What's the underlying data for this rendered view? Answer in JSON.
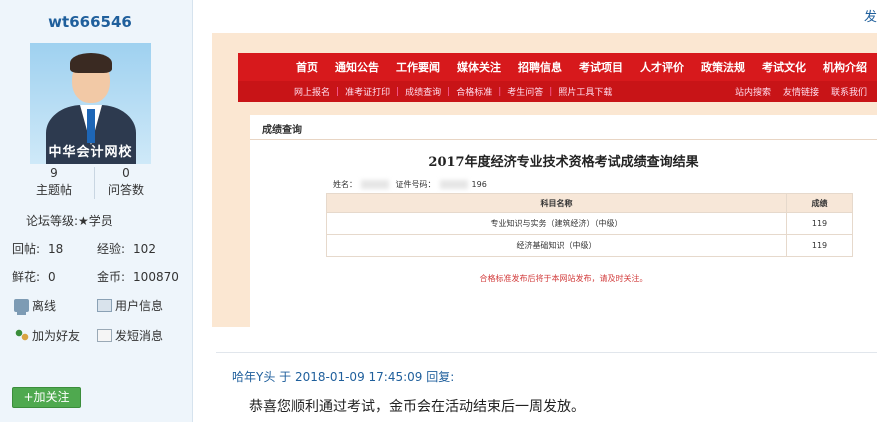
{
  "user": {
    "name": "wt666546",
    "avatar_text": "中华会计网校",
    "topics_count": "9",
    "topics_label": "主题帖",
    "questions_count": "0",
    "questions_label": "问答数",
    "level_label": "论坛等级:",
    "level_value": "★学员",
    "replies_label": "回帖:",
    "replies_value": "18",
    "exp_label": "经验:",
    "exp_value": "102",
    "flowers_label": "鲜花:",
    "flowers_value": "0",
    "coins_label": "金币:",
    "coins_value": "100870",
    "status_label": "离线",
    "userinfo_label": "用户信息",
    "add_friend_label": "加为好友",
    "send_msg_label": "发短消息",
    "follow_label": "+加关注"
  },
  "top_link": "发",
  "screenshot": {
    "nav": [
      "首页",
      "通知公告",
      "工作要闻",
      "媒体关注",
      "招聘信息",
      "考试项目",
      "人才评价",
      "政策法规",
      "考试文化",
      "机构介绍"
    ],
    "subnav": [
      "网上报名",
      "准考证打印",
      "成绩查询",
      "合格标准",
      "考生问答",
      "照片工具下载"
    ],
    "subnav_right": [
      "站内搜索",
      "友情链接",
      "联系我们"
    ],
    "panel_title": "成绩查询",
    "result_title": "2017年度经济专业技术资格考试成绩查询结果",
    "name_label": "姓名：",
    "id_label": "证件号码：",
    "id_suffix": "196",
    "col_subject": "科目名称",
    "col_score": "成绩",
    "rows": [
      {
        "subject": "专业知识与实务（建筑经济）（中级）",
        "score": "119"
      },
      {
        "subject": "经济基础知识（中级）",
        "score": "119"
      }
    ],
    "note": "合格标准发布后将于本网站发布，请及时关注。"
  },
  "reply": {
    "header": "哈年Y头 于 2018-01-09 17:45:09 回复:",
    "text": "恭喜您顺利通过考试，金币会在活动结束后一周发放。"
  },
  "colors": {
    "nav_red": "#d7191c",
    "link_blue": "#1f5f9c",
    "follow_green": "#4fa94f"
  }
}
